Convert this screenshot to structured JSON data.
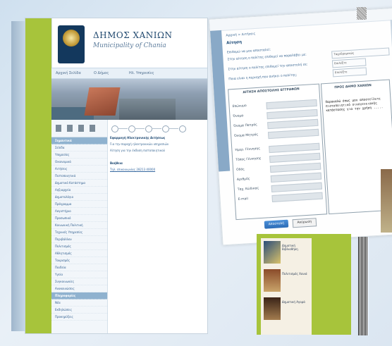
{
  "page1": {
    "title": "ΔΗΜΟΣ ΧΑΝΙΩΝ",
    "subtitle": "Municipality of Chania",
    "nav": [
      "Αρχική Σελίδα",
      "Ο Δήμος",
      "Ηλ. Υπηρεσίες"
    ],
    "sidebar_items": [
      "Σελίδα",
      "Υπηρεσίες",
      "Οικονομικά",
      "Αιτήσεις",
      "Πιστοποιητικά",
      "Δημοτικό Κατάστημα",
      "Ληξιαρχείο",
      "Δημοτολόγιο",
      "Πρόγραμμα",
      "Λογιστήριο",
      "Προσωπικό",
      "Κοινωνική Πολιτική",
      "Τεχνικές Υπηρεσίες",
      "Περιβάλλον",
      "Πολιτισμός",
      "Αθλητισμός",
      "Τουρισμός",
      "Παιδεία",
      "Υγεία",
      "Συγκοινωνίες",
      "Ανακοινώσεις",
      "Νέα",
      "Εκδηλώσεις",
      "Προκηρύξεις"
    ],
    "sidebar_sections": [
      "Σημαντικά",
      "Πληροφορίες"
    ],
    "main_lines": [
      "Εφαρμογή Ηλεκτρονικής Αιτήσεως",
      "Για την παροχή ηλεκτρονικών υπηρεσιών",
      "Αίτηση για την έκδοση πιστοποιητικού",
      "Βοήθεια",
      "Τηλ. επικοινωνίας 28213 40000"
    ]
  },
  "page2": {
    "breadcrumb": "Αρχική > Αιτήσεις",
    "heading": "Αίτηση",
    "questions": [
      "Επιθυμώ να μου αποσταλεί:",
      "Στην αίτηση ο πολίτης επιθυμεί να παραλάβει με:",
      "Στην αίτηση ο πολίτης επιθυμεί την αποστολή σε:",
      "Ποια είναι η περιοχή που ανήκει ο πολίτης;"
    ],
    "select_values": [
      "Ταχυδρομικώς",
      "Επιλέξτε",
      "Επιλέξτε"
    ],
    "left_panel_title": "ΑΙΤΗΣΗ ΑΠΟΣΤΟΛΗΣ ΕΓΓΡΑΦΩΝ",
    "fields": [
      "Επώνυμο",
      "Όνομα",
      "Όνομα Πατρός",
      "Όνομα Μητρός",
      "Ημερ. Γέννησης",
      "Τόπος Γέννησης",
      "Οδός",
      "Αριθμός",
      "Ταχ. Κώδικας",
      "E-mail"
    ],
    "right_panel_title": "ΠΡΟΣ ΔΗΜΟ ΧΑΝΙΩΝ",
    "right_panel_text": "Παρακαλώ όπως μου αποστείλετε πιστοποιητικό οικογενειακής κατάστασης για την χρήση .....",
    "submit_label": "Αποστολή",
    "cancel_label": "Ακύρωση"
  },
  "page3": {
    "ads": [
      "Δημοτική Βιβλιοθήκη",
      "Πολιτισμός Χανιά",
      "Δημοτική Αγορά"
    ]
  }
}
